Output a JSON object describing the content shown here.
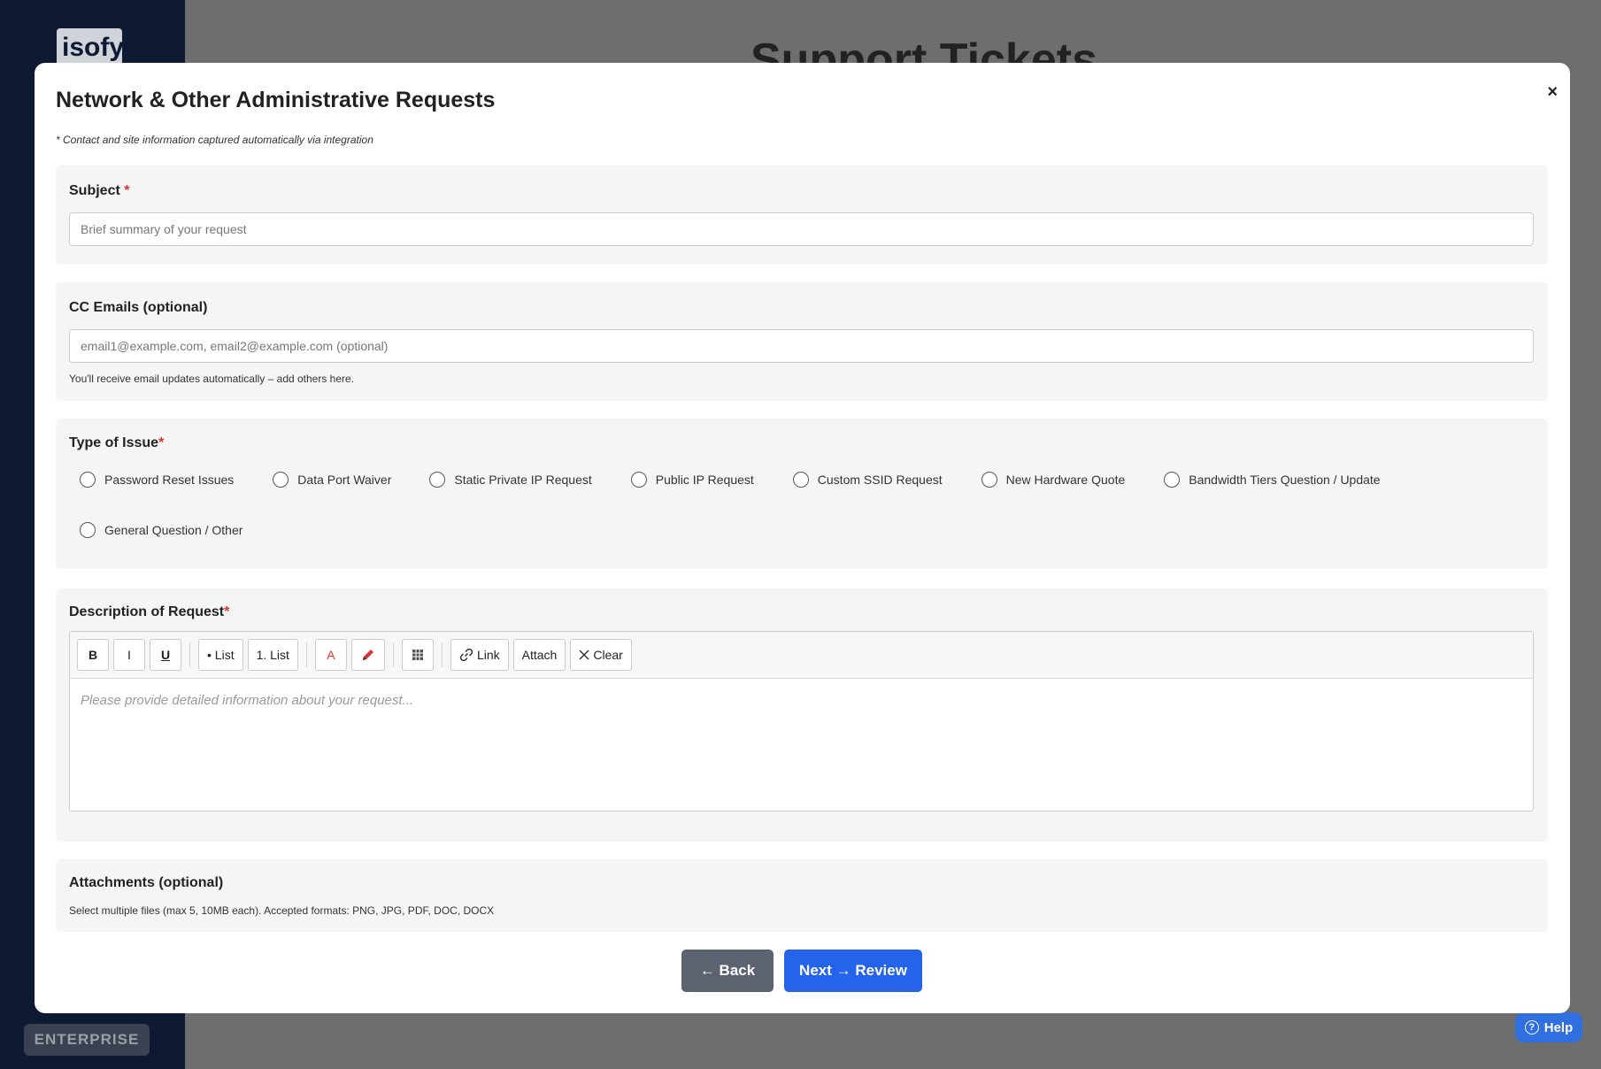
{
  "background": {
    "logo": "isofy",
    "page_title": "Support Tickets",
    "enterprise_label": "ENTERPRISE",
    "help_label": "Help"
  },
  "modal": {
    "title": "Network & Other Administrative Requests",
    "close_label": "×",
    "note": "* Contact and site information captured automatically via integration",
    "subject": {
      "label": "Subject",
      "required_mark": "*",
      "placeholder": "Brief summary of your request",
      "value": ""
    },
    "cc": {
      "label": "CC Emails (optional)",
      "placeholder": "email1@example.com, email2@example.com (optional)",
      "value": "",
      "hint": "You'll receive email updates automatically – add others here."
    },
    "issue_type": {
      "label": "Type of Issue",
      "required_mark": "*",
      "options": [
        "Password Reset Issues",
        "Data Port Waiver",
        "Static Private IP Request",
        "Public IP Request",
        "Custom SSID Request",
        "New Hardware Quote",
        "Bandwidth Tiers Question / Update",
        "General Question / Other"
      ],
      "selected": null
    },
    "description": {
      "label": "Description of Request",
      "required_mark": "*",
      "toolbar": {
        "bold": "B",
        "italic": "I",
        "underline": "U",
        "bullet_list": "• List",
        "numbered_list": "1. List",
        "text_color": "A",
        "highlight_icon": "pencil-icon",
        "table_icon": "table-icon",
        "link": "Link",
        "attach": "Attach",
        "clear": "Clear"
      },
      "placeholder": "Please provide detailed information about your request..."
    },
    "attachments": {
      "label": "Attachments (optional)",
      "hint": "Select multiple files (max 5, 10MB each). Accepted formats: PNG, JPG, PDF, DOC, DOCX"
    },
    "buttons": {
      "back": "← Back",
      "next": "Next → Review"
    }
  },
  "colors": {
    "primary": "#2563eb",
    "secondary": "#5c6370",
    "required": "#dd3333",
    "sidebar": "#0e1a33"
  }
}
